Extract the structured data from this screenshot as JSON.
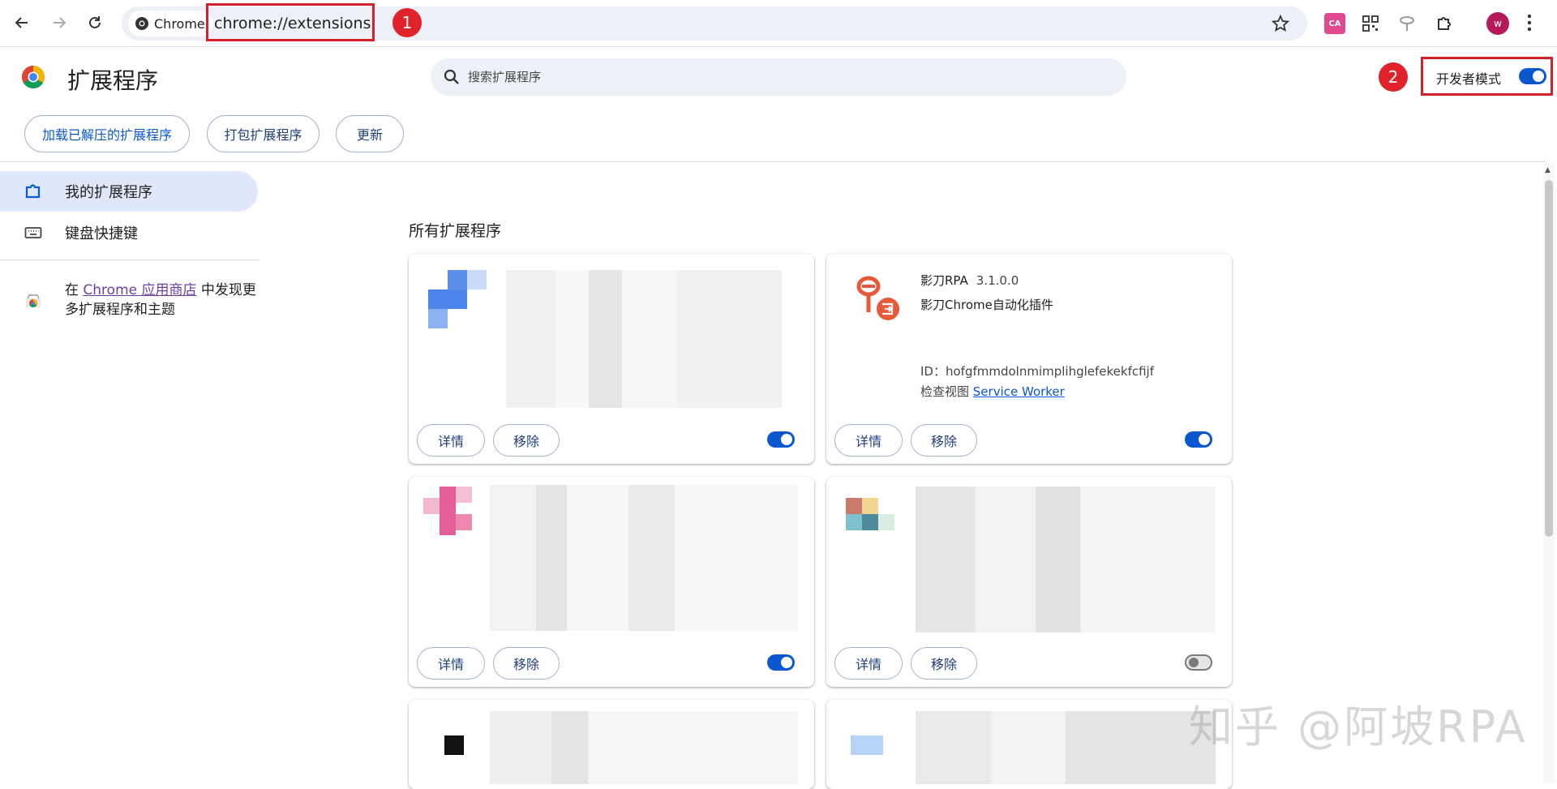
{
  "browser": {
    "site_chip_label": "Chrome",
    "url": "chrome://extensions",
    "annotation_1": "1",
    "annotation_2": "2",
    "avatar_initial": "w",
    "ext_icon_translate": "CA"
  },
  "header": {
    "title": "扩展程序",
    "search_placeholder": "搜索扩展程序",
    "dev_mode_label": "开发者模式"
  },
  "toolbar": {
    "load_unpacked": "加载已解压的扩展程序",
    "pack": "打包扩展程序",
    "update": "更新"
  },
  "sidebar": {
    "items": [
      {
        "label": "我的扩展程序"
      },
      {
        "label": "键盘快捷键"
      }
    ],
    "store_prefix": "在 ",
    "store_link": "Chrome 应用商店",
    "store_suffix": " 中发现更多扩展程序和主题"
  },
  "main": {
    "section_title": "所有扩展程序",
    "detail_label": "详情",
    "remove_label": "移除",
    "featured": {
      "name": "影刀RPA",
      "version": "3.1.0.0",
      "description": "影刀Chrome自动化插件",
      "id_text": "ID：hofgfmmdolnmimplihglefekekfcfijf",
      "inspect_prefix": "检查视图 ",
      "inspect_link": "Service Worker"
    }
  },
  "watermark": "知乎 @阿坡RPA",
  "colors": {
    "accent": "#0b57d0",
    "highlight": "#d4222a",
    "sidebar_active": "#dfe8fb"
  }
}
